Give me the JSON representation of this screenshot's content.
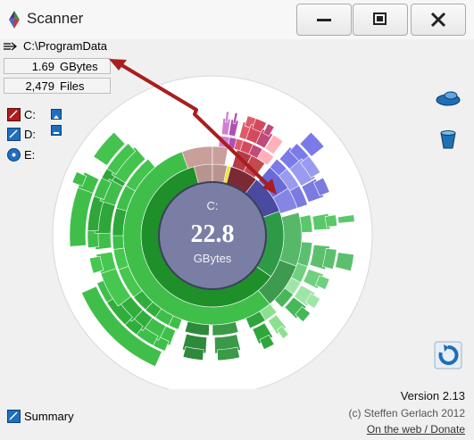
{
  "window": {
    "title": "Scanner"
  },
  "path": {
    "text": "C:\\ProgramData"
  },
  "info": {
    "size_value": "1.69",
    "size_unit": "GBytes",
    "files_value": "2,479",
    "files_unit": "Files"
  },
  "drives": [
    {
      "label": "C:"
    },
    {
      "label": "D:"
    },
    {
      "label": "E:"
    }
  ],
  "center": {
    "drive": "C:",
    "size": "22.8",
    "unit": "GBytes"
  },
  "summary": {
    "label": "Summary"
  },
  "footer": {
    "version": "Version 2.13",
    "copyright": "(c) Steffen Gerlach 2012",
    "link": "On the web / Donate"
  },
  "colors": {
    "accent": "#1e6fbf",
    "center": "#7a7ea5",
    "annotation": "#a81e1e"
  }
}
